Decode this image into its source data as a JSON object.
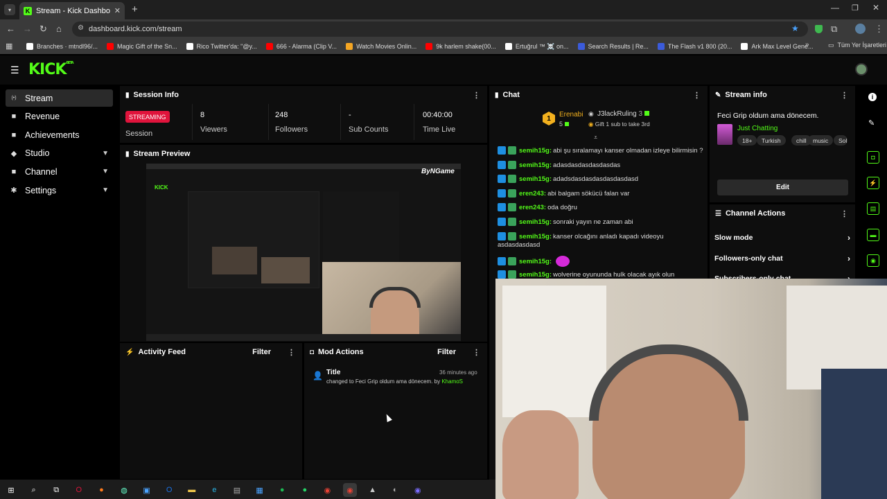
{
  "browser": {
    "tab_title": "Stream - Kick Dashboard",
    "url": "dashboard.kick.com/stream",
    "bookmarks": [
      {
        "label": "Branches · mtndl96/...",
        "color": "#ffffff"
      },
      {
        "label": "Magic Gift of the Sn...",
        "color": "#ff0000"
      },
      {
        "label": "Rico Twitter'da: \"@y...",
        "color": "#ffffff"
      },
      {
        "label": "666 - Alarma (Clip V...",
        "color": "#ff0000"
      },
      {
        "label": "Watch Movies Onlin...",
        "color": "#f5a623"
      },
      {
        "label": "9k harlem shake(00...",
        "color": "#ff0000"
      },
      {
        "label": "Ertuğrul ™ ☠️ on...",
        "color": "#ffffff"
      },
      {
        "label": "Search Results | Re...",
        "color": "#3b5bdb"
      },
      {
        "label": "The Flash v1 800 (20...",
        "color": "#3b5bdb"
      },
      {
        "label": "Ark Max Level Gene...",
        "color": "#ffffff"
      }
    ],
    "all_bookmarks": "Tüm Yer İşaretleri"
  },
  "app": {
    "logo": "KICK",
    "logo_badge": "BETA",
    "accent": "#53fc18"
  },
  "sidebar": {
    "items": [
      {
        "label": "Stream",
        "icon": "broadcast-icon"
      },
      {
        "label": "Revenue",
        "icon": "wallet-icon"
      },
      {
        "label": "Achievements",
        "icon": "trophy-icon"
      },
      {
        "label": "Studio",
        "icon": "studio-icon"
      },
      {
        "label": "Channel",
        "icon": "channel-icon"
      },
      {
        "label": "Settings",
        "icon": "gear-icon"
      }
    ]
  },
  "session": {
    "title": "Session Info",
    "status": "STREAMING",
    "session_label": "Session",
    "viewers": "8",
    "viewers_label": "Viewers",
    "followers": "248",
    "followers_label": "Followers",
    "sub_counts": "-",
    "sub_counts_label": "Sub Counts",
    "time_live": "00:40:00",
    "time_live_label": "Time Live"
  },
  "preview": {
    "title": "Stream Preview",
    "watermark": "ByNGame"
  },
  "activity": {
    "title": "Activity Feed",
    "filter": "Filter"
  },
  "mod_actions": {
    "title": "Mod Actions",
    "filter": "Filter",
    "entry_title": "Title",
    "entry_time": "36 minutes ago",
    "entry_text": "changed to Feci Grip oldum ama dönecem. by",
    "entry_user": "KhamoS"
  },
  "chat": {
    "title": "Chat",
    "pinned": {
      "rank": "1",
      "user": "Erenabi",
      "user_count": "5",
      "gifter": "J3lackRuling",
      "gifter_count": "3",
      "gift_text": "Gift 1 sub to take 3rd"
    },
    "messages": [
      {
        "user": "semih15g:",
        "text": "abi şu sıralamayı kanser olmadan izleye bilirmisin ?"
      },
      {
        "user": "semih15g:",
        "text": "adasdasdasdasdasdas"
      },
      {
        "user": "semih15g:",
        "text": "adadsdasdasdasdasdasdasd"
      },
      {
        "user": "eren243:",
        "text": "abi balgam sökücü falan var"
      },
      {
        "user": "eren243:",
        "text": "oda doğru"
      },
      {
        "user": "semih15g:",
        "text": "sonraki yayın ne zaman abi"
      },
      {
        "user": "semih15g:",
        "text": "kanser olcağını anladı kapadı videoyu"
      },
      {
        "user": "",
        "text": "asdasdasdasd"
      },
      {
        "user": "semih15g:",
        "text": ""
      },
      {
        "user": "semih15g:",
        "text": "wolverine oyununda hulk olacak ayık olun"
      }
    ]
  },
  "stream_info": {
    "title": "Stream info",
    "stream_title": "Feci Grip oldum ama dönecem.",
    "category": "Just Chatting",
    "tags": [
      "18+",
      "Turkish",
      "chill",
      "music",
      "Sol"
    ],
    "edit": "Edit"
  },
  "channel_actions": {
    "title": "Channel Actions",
    "items": [
      "Slow mode",
      "Followers-only chat",
      "Subscribers-only chat"
    ]
  }
}
